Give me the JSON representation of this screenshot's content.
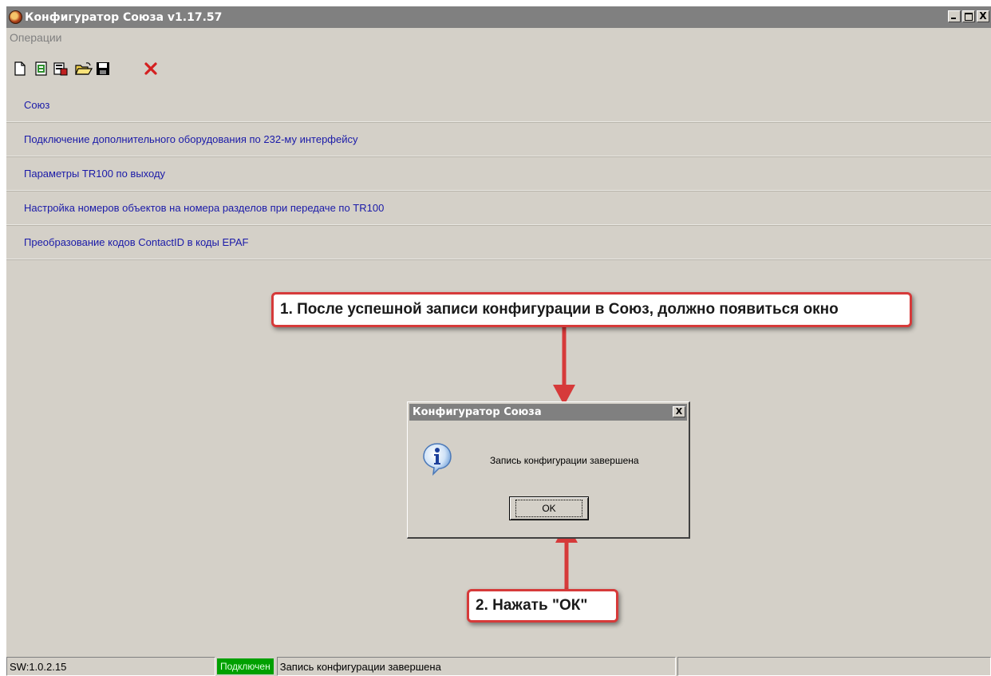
{
  "window": {
    "title": "Конфигуратор Союза v1.17.57",
    "controls": {
      "minimize": "_",
      "maximize": "□",
      "close": "X"
    }
  },
  "menu": {
    "items": [
      {
        "label": "Операции"
      }
    ]
  },
  "toolbar": {
    "buttons": [
      {
        "name": "new",
        "icon": "new-file-icon"
      },
      {
        "name": "read-config",
        "icon": "read-device-icon"
      },
      {
        "name": "write-config",
        "icon": "write-device-icon"
      },
      {
        "name": "open",
        "icon": "open-folder-icon"
      },
      {
        "name": "save",
        "icon": "floppy-disk-icon"
      },
      {
        "name": "close",
        "icon": "red-cross-icon"
      }
    ]
  },
  "sections": [
    {
      "label": "Союз"
    },
    {
      "label": "Подключение дополнительного оборудования по 232-му интерфейсу"
    },
    {
      "label": "Параметры TR100 по выходу"
    },
    {
      "label": "Настройка номеров объектов на номера разделов при передаче по TR100"
    },
    {
      "label": "Преобразование кодов ContactID в коды EPAF"
    }
  ],
  "annotations": {
    "step1": "1. После успешной записи конфигурации в Союз, должно появиться окно",
    "step2": "2. Нажать \"ОК\"",
    "color": "#d63a3a"
  },
  "dialog": {
    "title": "Конфигуратор Союза",
    "close_label": "X",
    "icon": "info-icon",
    "message": "Запись конфигурации завершена",
    "ok_label": "OK"
  },
  "statusbar": {
    "version": "SW:1.0.2.15",
    "connection": "Подключен",
    "connection_color": "#00a000",
    "status": "Запись конфигурации завершена",
    "extra": ""
  }
}
